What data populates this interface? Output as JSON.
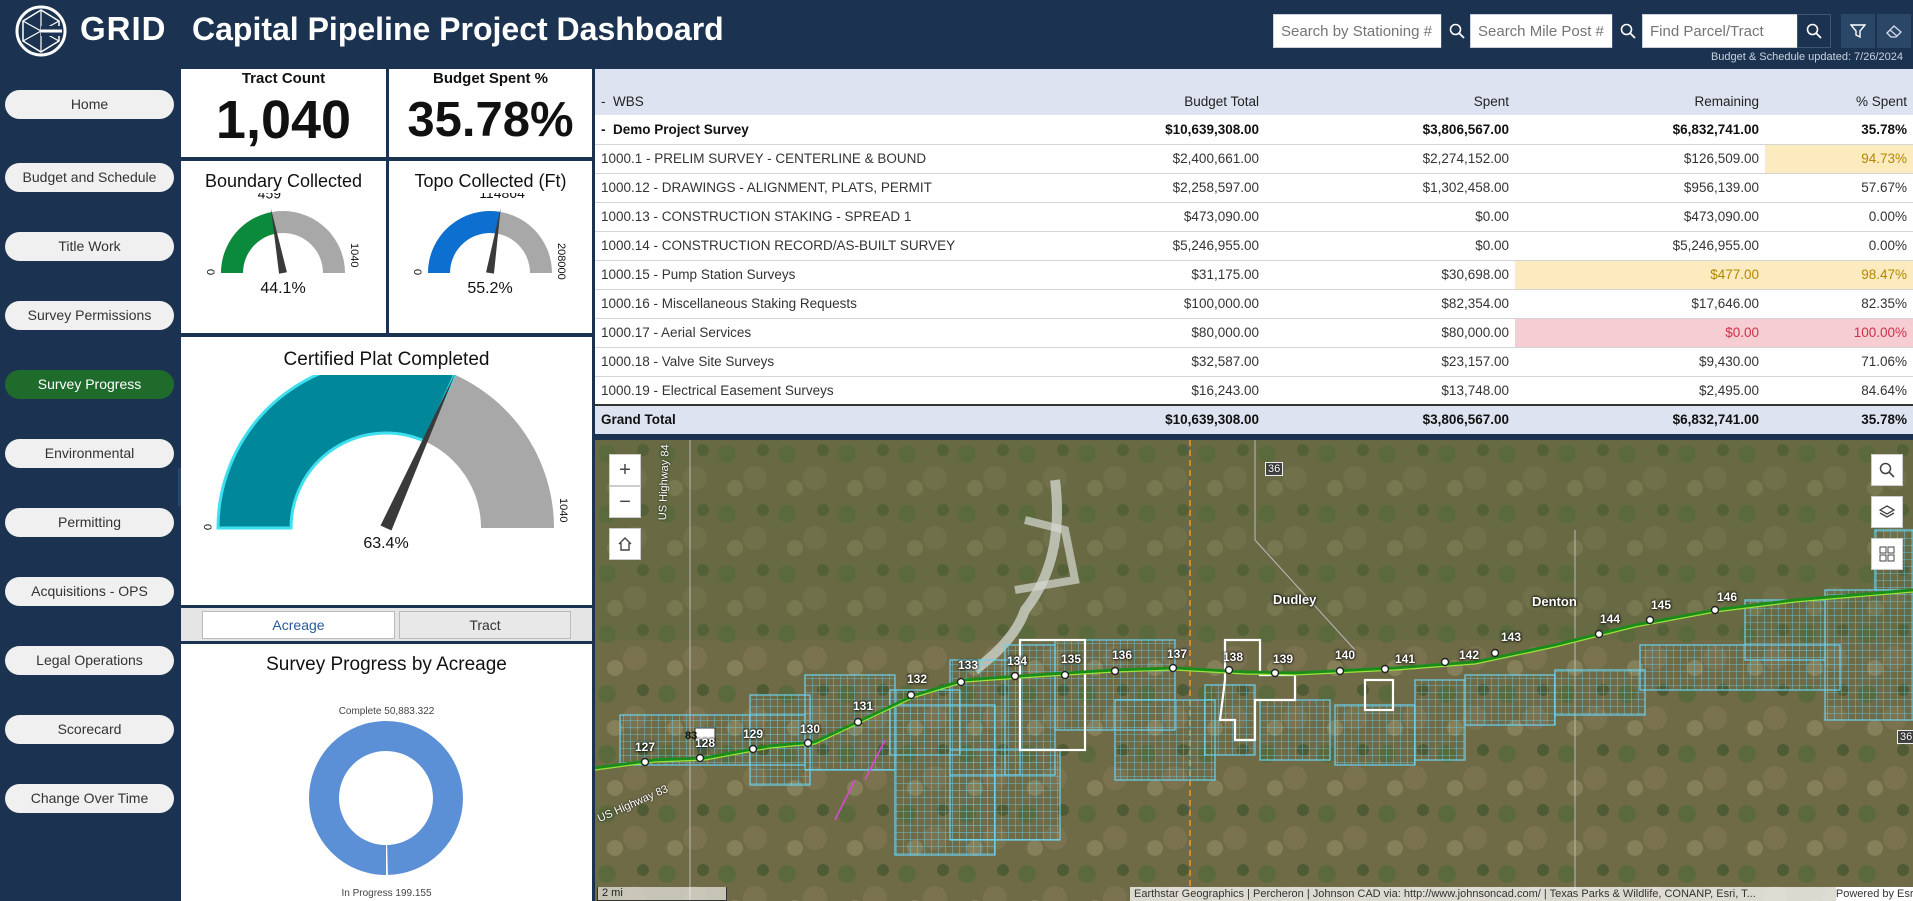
{
  "header": {
    "brand": "GRID",
    "title": "Capital Pipeline Project Dashboard",
    "search_stationing_placeholder": "Search by Stationing #",
    "search_milepost_placeholder": "Search Mile Post #",
    "search_parcel_placeholder": "Find Parcel/Tract",
    "updated": "Budget & Schedule updated: 7/26/2024"
  },
  "sidebar": {
    "items": [
      {
        "label": "Home"
      },
      {
        "label": "Budget and Schedule"
      },
      {
        "label": "Title Work"
      },
      {
        "label": "Survey Permissions"
      },
      {
        "label": "Survey Progress"
      },
      {
        "label": "Environmental"
      },
      {
        "label": "Permitting"
      },
      {
        "label": "Acquisitions - OPS"
      },
      {
        "label": "Legal Operations"
      },
      {
        "label": "Scorecard"
      },
      {
        "label": "Change Over Time"
      }
    ],
    "active": "Survey Progress"
  },
  "kpis": {
    "tract_count_title": "Tract Count",
    "tract_count": "1,040",
    "budget_spent_title": "Budget Spent %",
    "budget_spent": "35.78%"
  },
  "gauges": {
    "boundary": {
      "title": "Boundary Collected",
      "value": "459",
      "min": "0",
      "max": "1040",
      "percent": "44.1%",
      "fraction": 0.441,
      "color": "#0b8a3b"
    },
    "topo": {
      "title": "Topo Collected (Ft)",
      "value": "114864",
      "min": "0",
      "max": "208000",
      "percent": "55.2%",
      "fraction": 0.552,
      "color": "#0d6fcf"
    },
    "plat": {
      "title": "Certified Plat Completed",
      "value": "659",
      "min": "0",
      "max": "1040",
      "percent": "63.4%",
      "fraction": 0.634,
      "color": "#00879a"
    }
  },
  "tabs": {
    "acreage": "Acreage",
    "tract": "Tract"
  },
  "donut": {
    "title": "Survey Progress by Acreage",
    "complete_label": "Complete 50,883.322",
    "in_progress_label": "In Progress 199.155",
    "complete_value": 50883.322,
    "in_progress_value": 199.155,
    "color": "#5b8fd6"
  },
  "table": {
    "headers": [
      "WBS",
      "Budget Total",
      "Spent",
      "Remaining",
      "% Spent"
    ],
    "collapse_mark": "-",
    "rows": [
      {
        "cells": [
          "Demo Project Survey",
          "$10,639,308.00",
          "$3,806,567.00",
          "$6,832,741.00",
          "35.78%"
        ],
        "bold": true
      },
      {
        "cells": [
          "1000.1 - PRELIM SURVEY - CENTERLINE & BOUND",
          "$2,400,661.00",
          "$2,274,152.00",
          "$126,509.00",
          "94.73%"
        ],
        "warn": [
          4
        ]
      },
      {
        "cells": [
          "1000.12 - DRAWINGS - ALIGNMENT, PLATS, PERMIT",
          "$2,258,597.00",
          "$1,302,458.00",
          "$956,139.00",
          "57.67%"
        ]
      },
      {
        "cells": [
          "1000.13 - CONSTRUCTION STAKING - SPREAD 1",
          "$473,090.00",
          "$0.00",
          "$473,090.00",
          "0.00%"
        ]
      },
      {
        "cells": [
          "1000.14 - CONSTRUCTION RECORD/AS-BUILT SURVEY",
          "$5,246,955.00",
          "$0.00",
          "$5,246,955.00",
          "0.00%"
        ]
      },
      {
        "cells": [
          "1000.15 - Pump Station Surveys",
          "$31,175.00",
          "$30,698.00",
          "$477.00",
          "98.47%"
        ],
        "warn": [
          3,
          4
        ]
      },
      {
        "cells": [
          "1000.16 - Miscellaneous Staking Requests",
          "$100,000.00",
          "$82,354.00",
          "$17,646.00",
          "82.35%"
        ]
      },
      {
        "cells": [
          "1000.17 - Aerial Services",
          "$80,000.00",
          "$80,000.00",
          "$0.00",
          "100.00%"
        ],
        "bad": [
          3,
          4
        ]
      },
      {
        "cells": [
          "1000.18 - Valve Site Surveys",
          "$32,587.00",
          "$23,157.00",
          "$9,430.00",
          "71.06%"
        ]
      },
      {
        "cells": [
          "1000.19 - Electrical Easement Surveys",
          "$16,243.00",
          "$13,748.00",
          "$2,495.00",
          "84.64%"
        ]
      }
    ],
    "total": [
      "Grand Total",
      "$10,639,308.00",
      "$3,806,567.00",
      "$6,832,741.00",
      "35.78%"
    ]
  },
  "map": {
    "zoom_in": "+",
    "zoom_out": "−",
    "towns": [
      "Dudley",
      "Denton"
    ],
    "highways": [
      "US Highway 84",
      "US Highway 83",
      "36",
      "83",
      "36"
    ],
    "mileposts": [
      "127",
      "128",
      "129",
      "130",
      "131",
      "132",
      "133",
      "134",
      "135",
      "136",
      "137",
      "138",
      "139",
      "140",
      "141",
      "142",
      "143",
      "144",
      "145",
      "146"
    ],
    "scale": "2 mi",
    "attribution": "Earthstar Geographics | Percheron | Johnson CAD via: http://www.johnsoncad.com/ | Texas Parks & Wildlife, CONANP, Esri, T...",
    "powered_by": "Powered by Esri"
  }
}
